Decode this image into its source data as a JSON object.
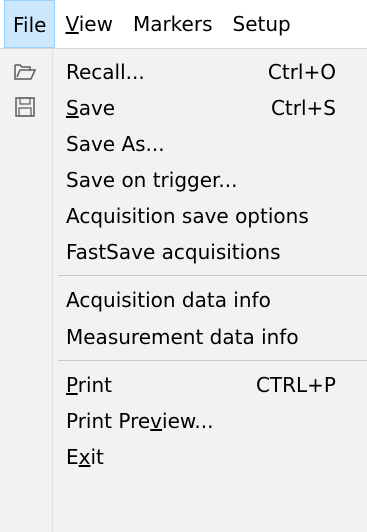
{
  "menubar": {
    "items": [
      {
        "pre": "",
        "mn": "File",
        "post": "",
        "active": true
      },
      {
        "pre": "",
        "mn": "V",
        "post": "iew",
        "active": false
      },
      {
        "pre": "Markers",
        "mn": "",
        "post": "",
        "active": false
      },
      {
        "pre": "Setup",
        "mn": "",
        "post": "",
        "active": false
      }
    ]
  },
  "file_menu": {
    "items": [
      {
        "icon": "folder-open-icon",
        "pre": "Recall...",
        "mn": "",
        "post": "",
        "shortcut": "Ctrl+O"
      },
      {
        "icon": "floppy-disk-icon",
        "pre": "",
        "mn": "S",
        "post": "ave",
        "shortcut": "Ctrl+S"
      },
      {
        "icon": "",
        "pre": "Save As...",
        "mn": "",
        "post": "",
        "shortcut": ""
      },
      {
        "icon": "",
        "pre": "Save on trigger...",
        "mn": "",
        "post": "",
        "shortcut": ""
      },
      {
        "icon": "",
        "pre": "Acquisition save options",
        "mn": "",
        "post": "",
        "shortcut": ""
      },
      {
        "icon": "",
        "pre": "FastSave acquisitions",
        "mn": "",
        "post": "",
        "shortcut": ""
      },
      {
        "icon": "",
        "pre": "Acquisition data info",
        "mn": "",
        "post": "",
        "shortcut": ""
      },
      {
        "icon": "",
        "pre": "Measurement data info",
        "mn": "",
        "post": "",
        "shortcut": ""
      },
      {
        "icon": "",
        "pre": "",
        "mn": "P",
        "post": "rint",
        "shortcut": "CTRL+P"
      },
      {
        "icon": "",
        "pre": "Print Pre",
        "mn": "v",
        "post": "iew...",
        "shortcut": ""
      },
      {
        "icon": "",
        "pre": "E",
        "mn": "x",
        "post": "it",
        "shortcut": ""
      }
    ]
  },
  "colors": {
    "active_menu_bg": "#cce8ff",
    "active_menu_border": "#99d1ff",
    "dropdown_bg": "#f2f2f2"
  }
}
